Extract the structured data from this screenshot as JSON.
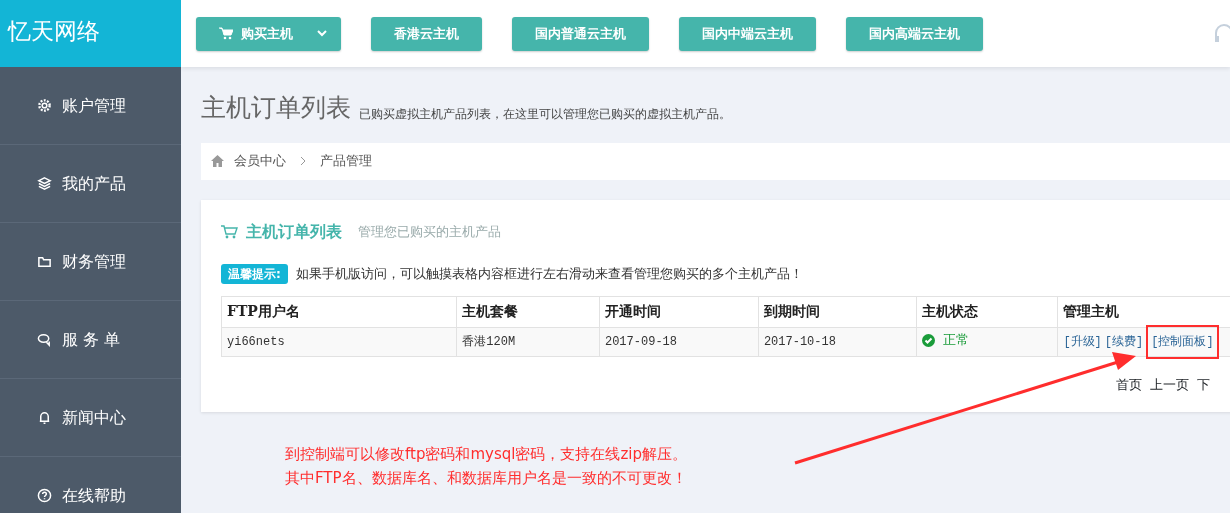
{
  "logo": "忆天网络",
  "top_buttons": [
    {
      "label": "购买主机",
      "kind": "dropdown"
    },
    {
      "label": "香港云主机",
      "kind": "plain"
    },
    {
      "label": "国内普通云主机",
      "kind": "plain"
    },
    {
      "label": "国内中端云主机",
      "kind": "plain"
    },
    {
      "label": "国内高端云主机",
      "kind": "plain"
    }
  ],
  "sidebar": {
    "items": [
      {
        "label": "账户管理"
      },
      {
        "label": "我的产品"
      },
      {
        "label": "财务管理"
      },
      {
        "label": "服 务 单"
      },
      {
        "label": "新闻中心"
      },
      {
        "label": "在线帮助"
      }
    ]
  },
  "page": {
    "title": "主机订单列表",
    "subtitle": "已购买虚拟主机产品列表，在这里可以管理您已购买的虚拟主机产品。"
  },
  "breadcrumb": [
    "会员中心",
    "产品管理"
  ],
  "card": {
    "title": "主机订单列表",
    "subtitle": "管理您已购买的主机产品",
    "tip_badge": "温馨提示:",
    "tip": "如果手机版访问，可以触摸表格内容框进行左右滑动来查看管理您购买的多个主机产品！"
  },
  "table": {
    "columns": [
      "FTP用户名",
      "主机套餐",
      "开通时间",
      "到期时间",
      "主机状态",
      "管理主机"
    ],
    "rows": [
      {
        "ftp_user": "yi66nets",
        "plan": "香港120M",
        "opened": "2017-09-18",
        "expires": "2017-10-18",
        "status": "正常",
        "ok": true,
        "actions": [
          "[升级]",
          "[续费]",
          "[控制面板]"
        ]
      }
    ]
  },
  "pagination": [
    "首页",
    "上一页",
    "下"
  ],
  "annotation": {
    "lines": [
      "到控制端可以修改ftp密码和mysql密码，支持在线zip解压。",
      "其中FTP名、数据库名、和数据库用户名是一致的不可更改！"
    ]
  }
}
